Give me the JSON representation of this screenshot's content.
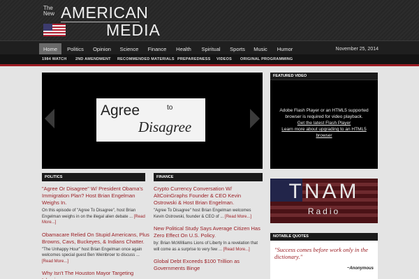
{
  "header": {
    "logo_the_new": "The New",
    "logo_american": "AMERICAN",
    "logo_media": "MEDIA"
  },
  "nav": {
    "items": [
      "Home",
      "Politics",
      "Opinion",
      "Science",
      "Finance",
      "Health",
      "Spiritual",
      "Sports",
      "Music",
      "Humor"
    ],
    "active": "Home",
    "date": "November 25, 2014"
  },
  "subnav": {
    "items": [
      "1984 WATCH",
      "2ND AMENDMENT",
      "RECOMMENDED MATERIALS",
      "PREPAREDNESS",
      "VIDEOS",
      "ORIGINAL PROGRAMMING"
    ]
  },
  "slider": {
    "line1": "Agree",
    "line_to": "to",
    "line2": "Disagree"
  },
  "politics": {
    "heading": "POLITICS",
    "articles": [
      {
        "title": "\"Agree Or Disagree\" W/ President Obama's Immigration Plan? Host Brian Engelman Weighs In.",
        "desc": "On this episode of \"Agree To Disagree\", host Brian Engelman weighs in on the illegal alien debate ...",
        "more": "[Read More...]"
      },
      {
        "title": "Obamacare Relied On Stupid Americans, Plus Browns, Cavs, Buckeyes, & Indians Chatter.",
        "desc": "\"The Unhappy Hour\" host Brian Engelman once again welcomes special guest Ben Weinbroer to discuss ...",
        "more": "[Read More...]"
      },
      {
        "title": "Why Isn't The Houston Mayor Targeting Islamic",
        "desc": "",
        "more": ""
      }
    ]
  },
  "finance": {
    "heading": "FINANCE",
    "articles": [
      {
        "title": "Crypto Currency Conversation W/ AltCoinGraphs Founder & CEO Kevin Ostrowski & Host Brian Engelman.",
        "desc": "\"Agree To Disagree\" host Brian Engelman welcomes Kevin Ostrowski, founder & CEO of ...",
        "more": "[Read More...]"
      },
      {
        "title": "New Political Study Says Average Citizen Has Zero Effect On U.S. Policy.",
        "desc": "by: Brian McWilliams Lions of Liberty In a revelation that will come as a surprise to very few ...",
        "more": "[Read More...]"
      },
      {
        "title": "Global Debt Exceeds $100 Trillion as Governments Binge",
        "desc": "",
        "more": ""
      }
    ]
  },
  "featured": {
    "heading": "FEATURED VIDEO",
    "message": "Adobe Flash Player or an HTML5 supported browser is required for video playback.",
    "link1": "Get the latest Flash Player",
    "link2": "Learn more about upgrading to an HTML5 browser"
  },
  "radio": {
    "title": "TNAM",
    "word": "Radio"
  },
  "quotes": {
    "heading": "NOTABLE QUOTES",
    "text": "\"Success comes before work only in the dictionary.\"",
    "author": "~Anonymous"
  },
  "colors": {
    "accent_red": "#9b1f25",
    "header_dark": "#2a2a2a"
  },
  "icons": [
    "flag-icon",
    "arrow-left-icon",
    "arrow-right-icon"
  ]
}
